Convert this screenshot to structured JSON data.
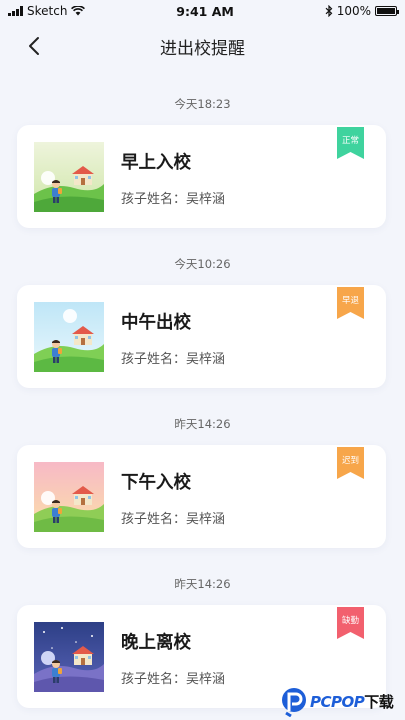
{
  "status_bar": {
    "carrier": "Sketch",
    "time": "9:41 AM",
    "battery": "100%",
    "battery_level": 1.0
  },
  "header": {
    "title": "进出校提醒",
    "back_icon": "chevron-left-icon"
  },
  "entries": [
    {
      "time": "今天18:23",
      "title": "早上入校",
      "child": "孩子姓名：吴梓涵",
      "badge": "正常",
      "badge_color": "#3fd39e",
      "scene": "morning"
    },
    {
      "time": "今天10:26",
      "title": "中午出校",
      "child": "孩子姓名：吴梓涵",
      "badge": "早退",
      "badge_color": "#f7a64a",
      "scene": "noon"
    },
    {
      "time": "昨天14:26",
      "title": "下午入校",
      "child": "孩子姓名：吴梓涵",
      "badge": "迟到",
      "badge_color": "#f7a64a",
      "scene": "afternoon"
    },
    {
      "time": "昨天14:26",
      "title": "晚上离校",
      "child": "孩子姓名：吴梓涵",
      "badge": "缺勤",
      "badge_color": "#f2606e",
      "scene": "night"
    }
  ],
  "watermark": {
    "text": "PCPOP",
    "suffix": "下载"
  }
}
